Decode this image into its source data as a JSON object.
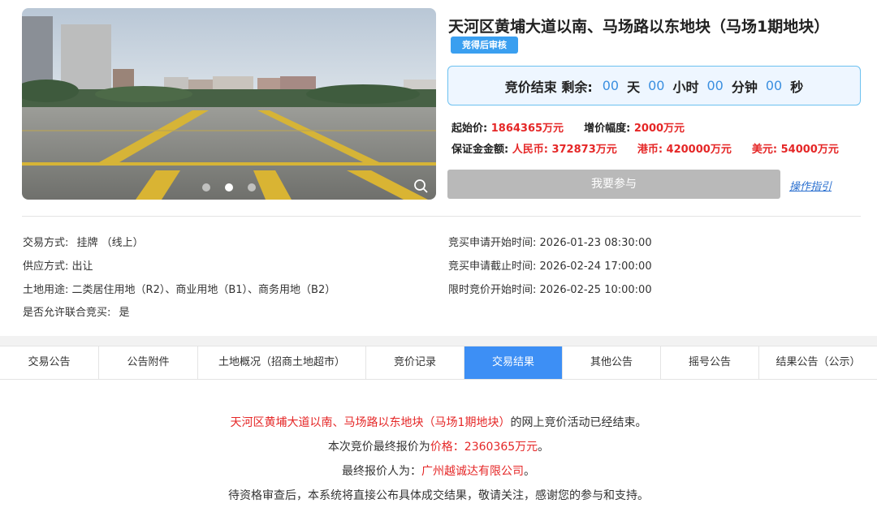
{
  "listing": {
    "title": "天河区黄埔大道以南、马场路以东地块（马场1期地块）",
    "badge": "竞得后审核"
  },
  "carousel": {
    "dots": 3,
    "active_dot": 1,
    "zoom_icon": "magnifier-icon"
  },
  "countdown": {
    "label": "竞价结束  剩余:",
    "days": "00",
    "days_unit": "天",
    "hours": "00",
    "hours_unit": "小时",
    "minutes": "00",
    "minutes_unit": "分钟",
    "seconds": "00",
    "seconds_unit": "秒"
  },
  "price": {
    "start_label": "起始价:",
    "start_value": "1864365万元",
    "increment_label": "增价幅度:",
    "increment_value": "2000万元",
    "deposit_label": "保证金金额:",
    "rmb_label": "人民币:",
    "rmb_value": "372873万元",
    "hkd_label": "港币:",
    "hkd_value": "420000万元",
    "usd_label": "美元:",
    "usd_value": "54000万元"
  },
  "actions": {
    "join_label": "我要参与",
    "guide_label": "操作指引"
  },
  "details_left": [
    {
      "label": "交易方式:",
      "value": "挂牌 （线上）"
    },
    {
      "label": "供应方式:",
      "value": "出让"
    },
    {
      "label": "土地用途:",
      "value": "二类居住用地（R2）、商业用地（B1）、商务用地（B2）"
    },
    {
      "label": "是否允许联合竞买:",
      "value": "是"
    }
  ],
  "details_right": [
    {
      "label": "竞买申请开始时间:",
      "value": "2026-01-23 08:30:00"
    },
    {
      "label": "竞买申请截止时间:",
      "value": "2026-02-24 17:00:00"
    },
    {
      "label": "限时竞价开始时间:",
      "value": "2026-02-25 10:00:00"
    }
  ],
  "tabs": [
    {
      "label": "交易公告"
    },
    {
      "label": "公告附件"
    },
    {
      "label": "土地概况（招商土地超市）"
    },
    {
      "label": "竞价记录"
    },
    {
      "label": "交易结果"
    },
    {
      "label": "其他公告"
    },
    {
      "label": "摇号公告"
    },
    {
      "label": "结果公告（公示）"
    }
  ],
  "active_tab": 4,
  "result": {
    "line1_red": "天河区黄埔大道以南、马场路以东地块（马场1期地块）",
    "line1_rest": "的网上竞价活动已经结束。",
    "line2_prefix": "本次竞价最终报价为",
    "line2_red": "价格：2360365万元",
    "line2_suffix": "。",
    "line3_prefix": "最终报价人为：",
    "line3_red": "广州越诚达有限公司",
    "line3_suffix": "。",
    "line4": "待资格审查后，本系统将直接公布具体成交结果，敬请关注，感谢您的参与和支持。"
  }
}
